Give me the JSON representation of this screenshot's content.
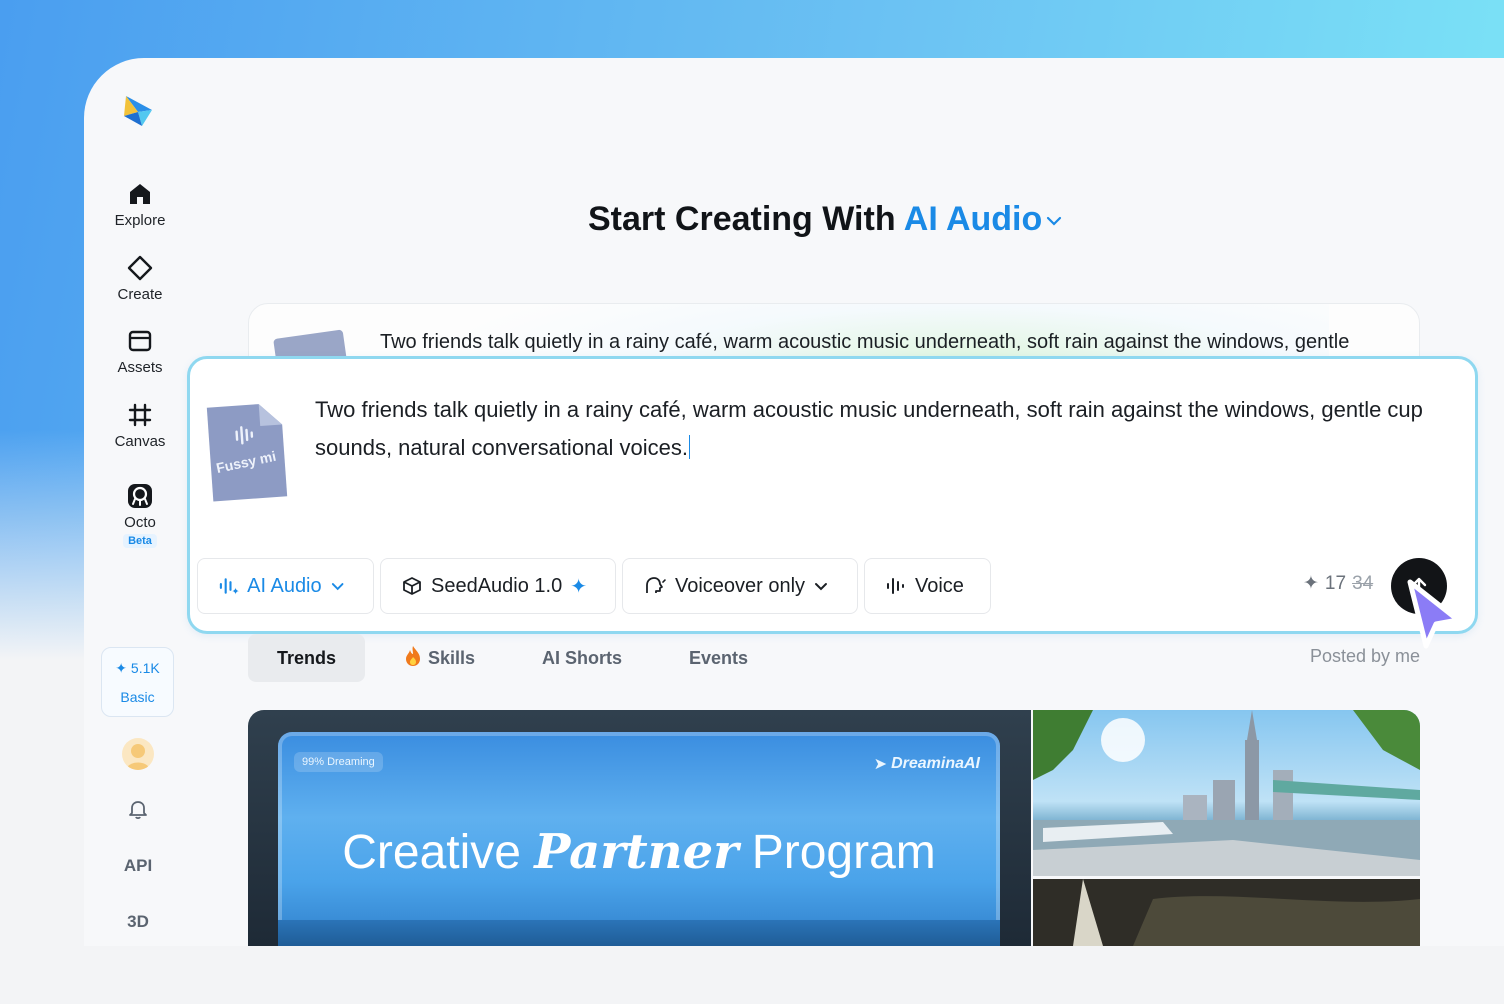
{
  "sidebar": {
    "items": [
      {
        "label": "Explore",
        "icon": "home-icon"
      },
      {
        "label": "Create",
        "icon": "diamond-icon"
      },
      {
        "label": "Assets",
        "icon": "folder-icon"
      },
      {
        "label": "Canvas",
        "icon": "frame-icon"
      },
      {
        "label": "Octo",
        "icon": "octo-icon",
        "badge": "Beta"
      }
    ],
    "credits": {
      "amount": "5.1K",
      "plan": "Basic"
    },
    "api_label": "API",
    "three_d_label": "3D"
  },
  "headline": {
    "prefix": "Start Creating With",
    "mode": "AI Audio"
  },
  "back_card": {
    "text": "Two friends talk quietly in a rainy café, warm acoustic music underneath, soft rain against the windows, gentle"
  },
  "prompt": {
    "file_label": "Fussy mi",
    "text": "Two friends talk quietly in a rainy café, warm acoustic music underneath, soft rain against the windows, gentle cup sounds, natural conversational voices."
  },
  "toolbar": {
    "mode_label": "AI Audio",
    "model_label": "SeedAudio 1.0",
    "type_label": "Voiceover only",
    "voice_label": "Voice",
    "cost": "17",
    "cost_original": "34"
  },
  "tabs": [
    {
      "label": "Trends",
      "active": true
    },
    {
      "label": "Skills",
      "active": false
    },
    {
      "label": "AI Shorts",
      "active": false
    },
    {
      "label": "Events",
      "active": false
    }
  ],
  "posted_by_me": "Posted by me",
  "banner": {
    "tag": "99% Dreaming",
    "brand": "DreaminaAI",
    "title_before": "Creative ",
    "title_italic": "Partner",
    "title_after": " Program"
  },
  "colors": {
    "accent": "#1a8ae6",
    "prompt_border": "#8fd8f0"
  }
}
